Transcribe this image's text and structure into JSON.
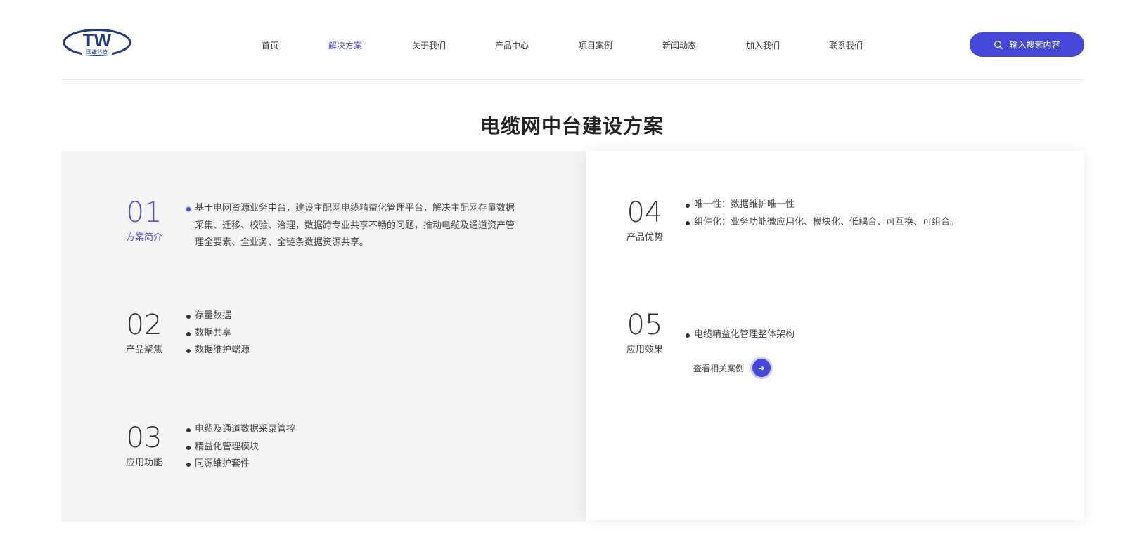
{
  "brand": {
    "logo_text": "TW",
    "logo_sub": "图维科技",
    "accent": "#4447d8"
  },
  "nav": {
    "items": [
      {
        "label": "首页",
        "active": false
      },
      {
        "label": "解决方案",
        "active": true
      },
      {
        "label": "关于我们",
        "active": false
      },
      {
        "label": "产品中心",
        "active": false
      },
      {
        "label": "项目案例",
        "active": false
      },
      {
        "label": "新闻动态",
        "active": false
      },
      {
        "label": "加入我们",
        "active": false
      },
      {
        "label": "联系我们",
        "active": false
      }
    ]
  },
  "search": {
    "label": "输入搜索内容",
    "icon": "search-icon"
  },
  "page": {
    "title": "电缆网中台建设方案"
  },
  "sections": [
    {
      "number": "01",
      "label": "方案简介",
      "items": [
        "基于电网资源业务中台，建设主配网电缆精益化管理平台，解决主配网存量数据采集、迁移、校验、治理，数据跨专业共享不畅的问题，推动电缆及通道资产管理全要素、全业务、全链条数据资源共享。"
      ]
    },
    {
      "number": "02",
      "label": "产品聚焦",
      "items": [
        "存量数据",
        "数据共享",
        "数据维护端源"
      ]
    },
    {
      "number": "03",
      "label": "应用功能",
      "items": [
        "电缆及通道数据采录管控",
        "精益化管理模块",
        "同源维护套件"
      ]
    },
    {
      "number": "04",
      "label": "产品优势",
      "items": [
        "唯一性：数据维护唯一性",
        "组件化：业务功能微应用化、模块化、低耦合、可互换、可组合。"
      ]
    },
    {
      "number": "05",
      "label": "应用效果",
      "items": [
        "电缆精益化管理整体架构"
      ],
      "link_label": "查看相关案例",
      "link_icon": "arrow-right-icon"
    }
  ]
}
